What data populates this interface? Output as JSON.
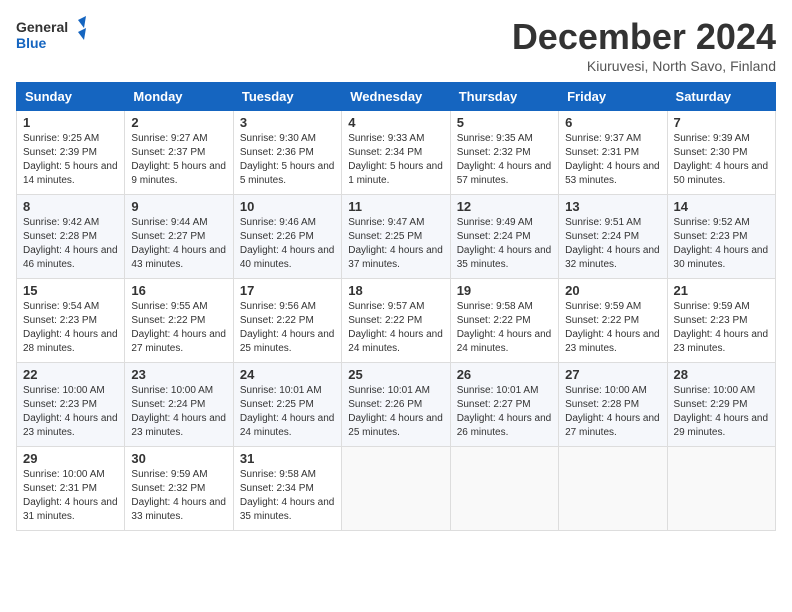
{
  "logo": {
    "text_general": "General",
    "text_blue": "Blue"
  },
  "header": {
    "month_title": "December 2024",
    "subtitle": "Kiuruvesi, North Savo, Finland"
  },
  "weekdays": [
    "Sunday",
    "Monday",
    "Tuesday",
    "Wednesday",
    "Thursday",
    "Friday",
    "Saturday"
  ],
  "weeks": [
    [
      {
        "day": "1",
        "sunrise": "9:25 AM",
        "sunset": "2:39 PM",
        "daylight": "5 hours and 14 minutes."
      },
      {
        "day": "2",
        "sunrise": "9:27 AM",
        "sunset": "2:37 PM",
        "daylight": "5 hours and 9 minutes."
      },
      {
        "day": "3",
        "sunrise": "9:30 AM",
        "sunset": "2:36 PM",
        "daylight": "5 hours and 5 minutes."
      },
      {
        "day": "4",
        "sunrise": "9:33 AM",
        "sunset": "2:34 PM",
        "daylight": "5 hours and 1 minute."
      },
      {
        "day": "5",
        "sunrise": "9:35 AM",
        "sunset": "2:32 PM",
        "daylight": "4 hours and 57 minutes."
      },
      {
        "day": "6",
        "sunrise": "9:37 AM",
        "sunset": "2:31 PM",
        "daylight": "4 hours and 53 minutes."
      },
      {
        "day": "7",
        "sunrise": "9:39 AM",
        "sunset": "2:30 PM",
        "daylight": "4 hours and 50 minutes."
      }
    ],
    [
      {
        "day": "8",
        "sunrise": "9:42 AM",
        "sunset": "2:28 PM",
        "daylight": "4 hours and 46 minutes."
      },
      {
        "day": "9",
        "sunrise": "9:44 AM",
        "sunset": "2:27 PM",
        "daylight": "4 hours and 43 minutes."
      },
      {
        "day": "10",
        "sunrise": "9:46 AM",
        "sunset": "2:26 PM",
        "daylight": "4 hours and 40 minutes."
      },
      {
        "day": "11",
        "sunrise": "9:47 AM",
        "sunset": "2:25 PM",
        "daylight": "4 hours and 37 minutes."
      },
      {
        "day": "12",
        "sunrise": "9:49 AM",
        "sunset": "2:24 PM",
        "daylight": "4 hours and 35 minutes."
      },
      {
        "day": "13",
        "sunrise": "9:51 AM",
        "sunset": "2:24 PM",
        "daylight": "4 hours and 32 minutes."
      },
      {
        "day": "14",
        "sunrise": "9:52 AM",
        "sunset": "2:23 PM",
        "daylight": "4 hours and 30 minutes."
      }
    ],
    [
      {
        "day": "15",
        "sunrise": "9:54 AM",
        "sunset": "2:23 PM",
        "daylight": "4 hours and 28 minutes."
      },
      {
        "day": "16",
        "sunrise": "9:55 AM",
        "sunset": "2:22 PM",
        "daylight": "4 hours and 27 minutes."
      },
      {
        "day": "17",
        "sunrise": "9:56 AM",
        "sunset": "2:22 PM",
        "daylight": "4 hours and 25 minutes."
      },
      {
        "day": "18",
        "sunrise": "9:57 AM",
        "sunset": "2:22 PM",
        "daylight": "4 hours and 24 minutes."
      },
      {
        "day": "19",
        "sunrise": "9:58 AM",
        "sunset": "2:22 PM",
        "daylight": "4 hours and 24 minutes."
      },
      {
        "day": "20",
        "sunrise": "9:59 AM",
        "sunset": "2:22 PM",
        "daylight": "4 hours and 23 minutes."
      },
      {
        "day": "21",
        "sunrise": "9:59 AM",
        "sunset": "2:23 PM",
        "daylight": "4 hours and 23 minutes."
      }
    ],
    [
      {
        "day": "22",
        "sunrise": "10:00 AM",
        "sunset": "2:23 PM",
        "daylight": "4 hours and 23 minutes."
      },
      {
        "day": "23",
        "sunrise": "10:00 AM",
        "sunset": "2:24 PM",
        "daylight": "4 hours and 23 minutes."
      },
      {
        "day": "24",
        "sunrise": "10:01 AM",
        "sunset": "2:25 PM",
        "daylight": "4 hours and 24 minutes."
      },
      {
        "day": "25",
        "sunrise": "10:01 AM",
        "sunset": "2:26 PM",
        "daylight": "4 hours and 25 minutes."
      },
      {
        "day": "26",
        "sunrise": "10:01 AM",
        "sunset": "2:27 PM",
        "daylight": "4 hours and 26 minutes."
      },
      {
        "day": "27",
        "sunrise": "10:00 AM",
        "sunset": "2:28 PM",
        "daylight": "4 hours and 27 minutes."
      },
      {
        "day": "28",
        "sunrise": "10:00 AM",
        "sunset": "2:29 PM",
        "daylight": "4 hours and 29 minutes."
      }
    ],
    [
      {
        "day": "29",
        "sunrise": "10:00 AM",
        "sunset": "2:31 PM",
        "daylight": "4 hours and 31 minutes."
      },
      {
        "day": "30",
        "sunrise": "9:59 AM",
        "sunset": "2:32 PM",
        "daylight": "4 hours and 33 minutes."
      },
      {
        "day": "31",
        "sunrise": "9:58 AM",
        "sunset": "2:34 PM",
        "daylight": "4 hours and 35 minutes."
      },
      null,
      null,
      null,
      null
    ]
  ],
  "labels": {
    "sunrise": "Sunrise: ",
    "sunset": "Sunset: ",
    "daylight": "Daylight: "
  }
}
